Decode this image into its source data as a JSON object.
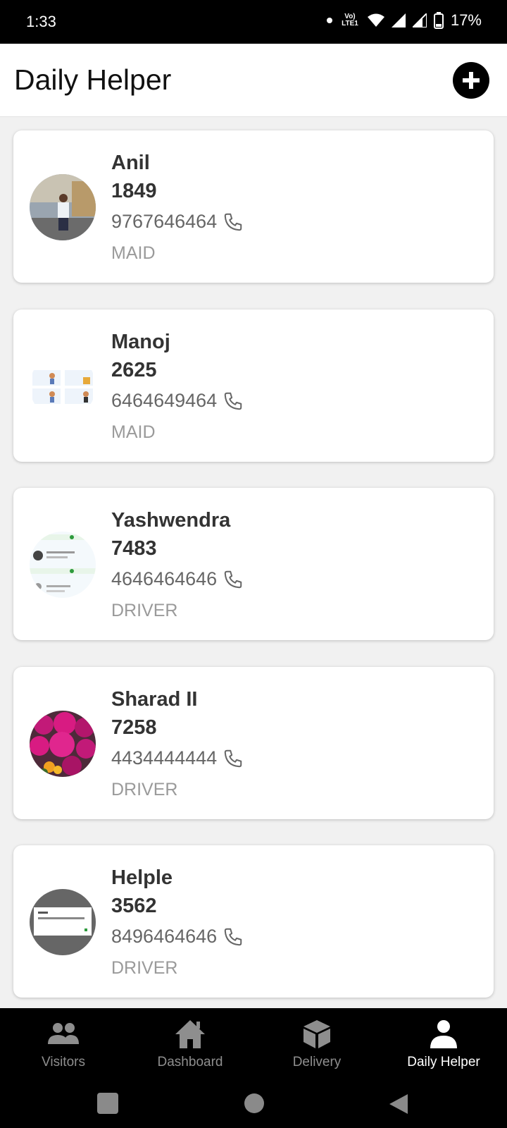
{
  "status_bar": {
    "time": "1:33",
    "network_label": "Vo) LTE1",
    "battery": "17%"
  },
  "header": {
    "title": "Daily Helper",
    "add_icon": "plus-circle-icon"
  },
  "helpers": [
    {
      "name": "Anil",
      "code": "1849",
      "phone": "9767646464",
      "role": "MAID"
    },
    {
      "name": "Manoj",
      "code": "2625",
      "phone": "6464649464",
      "role": "MAID"
    },
    {
      "name": "Yashwendra",
      "code": "7483",
      "phone": "4646464646",
      "role": "DRIVER"
    },
    {
      "name": "Sharad II",
      "code": "7258",
      "phone": "4434444444",
      "role": "DRIVER"
    },
    {
      "name": "Helple",
      "code": "3562",
      "phone": "8496464646",
      "role": "DRIVER"
    }
  ],
  "bottom_nav": [
    {
      "label": "Visitors",
      "icon": "people-icon",
      "active": false
    },
    {
      "label": "Dashboard",
      "icon": "home-icon",
      "active": false
    },
    {
      "label": "Delivery",
      "icon": "box-icon",
      "active": false
    },
    {
      "label": "Daily Helper",
      "icon": "person-icon",
      "active": true
    }
  ],
  "colors": {
    "accent": "#000000",
    "active_nav": "#ffffff",
    "inactive_nav": "#8e8e8e"
  }
}
